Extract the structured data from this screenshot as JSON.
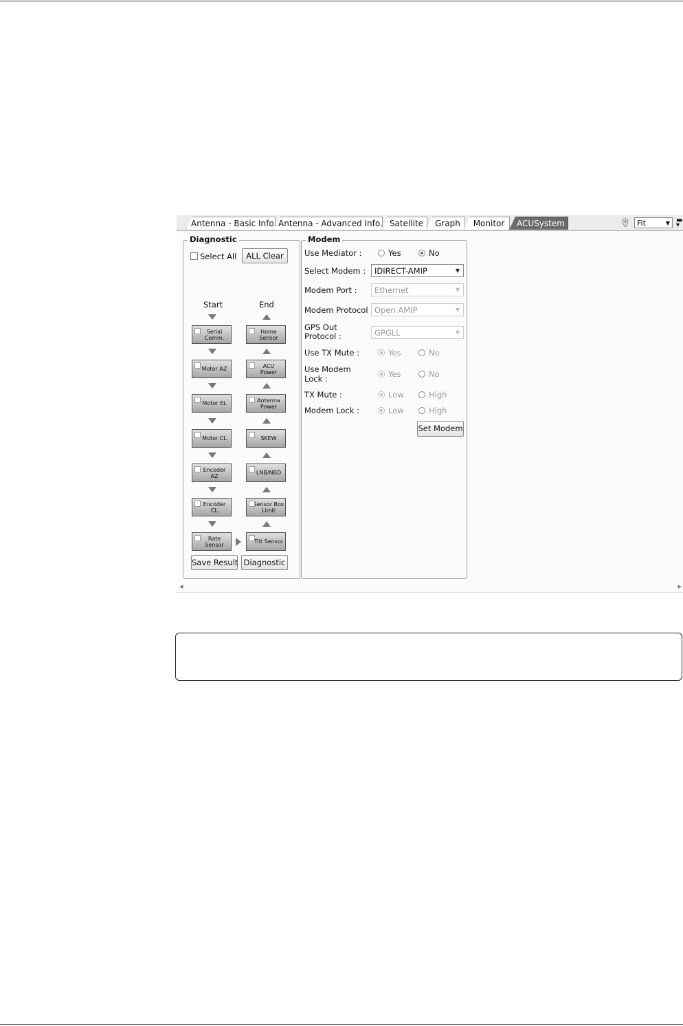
{
  "tabs": [
    {
      "label": "Antenna - Basic Info."
    },
    {
      "label": "Antenna - Advanced Info."
    },
    {
      "label": "Satellite"
    },
    {
      "label": "Graph"
    },
    {
      "label": "Monitor"
    },
    {
      "label": "ACUSystem",
      "active": true
    }
  ],
  "toolbar": {
    "zoom_value": "Fit",
    "location_icon": "map-pin-icon"
  },
  "diagnostic": {
    "legend": "Diagnostic",
    "select_all": "Select All",
    "all_clear": "ALL Clear",
    "start_label": "Start",
    "end_label": "End",
    "start_steps": [
      "Serial\nComm.",
      "Motor AZ",
      "Motor EL",
      "Motor CL",
      "Encoder\nAZ",
      "Encoder\nCL",
      "Rate\nSensor"
    ],
    "end_steps": [
      "Home\nSensor",
      "ACU\nPower",
      "Antenna\nPower",
      "SKEW",
      "LNB/NBD",
      "Sensor Box\nLimit",
      "Tilt Sensor"
    ],
    "save_result": "Save Result",
    "diagnostic_button": "Diagnostic"
  },
  "modem": {
    "legend": "Modem",
    "use_mediator_label": "Use Mediator :",
    "use_mediator_yes": "Yes",
    "use_mediator_no": "No",
    "use_mediator_value": "No",
    "select_modem_label": "Select Modem :",
    "select_modem_value": "IDIRECT-AMIP",
    "modem_port_label": "Modem Port :",
    "modem_port_value": "Ethernet",
    "modem_protocol_label": "Modem Protocol :",
    "modem_protocol_value": "Open AMIP",
    "gps_out_label": "GPS Out\nProtocol :",
    "gps_out_value": "GPGLL",
    "use_tx_mute_label": "Use TX Mute :",
    "use_modem_lock_label": "Use Modem\nLock :",
    "yes": "Yes",
    "no": "No",
    "tx_mute_label": "TX Mute :",
    "modem_lock_label": "Modem Lock :",
    "low": "Low",
    "high": "High",
    "set_modem": "Set Modem"
  },
  "colors": {
    "active_tab": "#6b6b6b",
    "box_gradient_top": "#e0e0e0",
    "box_gradient_bottom": "#a6a6a6"
  }
}
